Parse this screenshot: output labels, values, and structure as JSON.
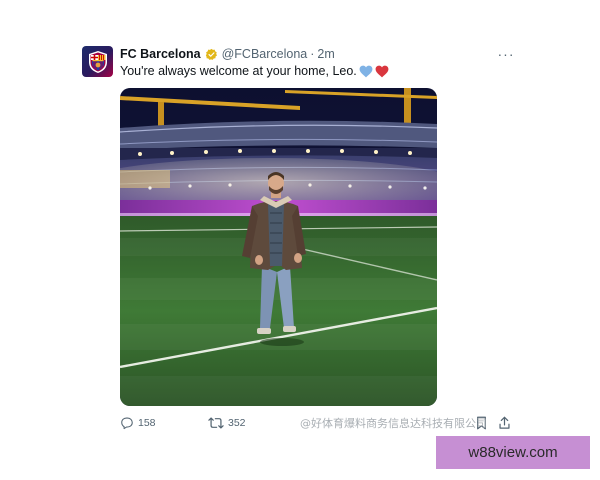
{
  "tweet": {
    "author_name": "FC Barcelona",
    "handle": "@FCBarcelona",
    "separator": "·",
    "time": "2m",
    "more_label": "···",
    "text": "You're always welcome at your home, Leo.",
    "image_alt": "Lionel Messi standing on the pitch of the stadium at night"
  },
  "actions": {
    "reply_count": "158",
    "retweet_count": "352"
  },
  "watermark": {
    "text": "@好体育爆料商务信息达科技有限公司",
    "site": "w88view.com"
  },
  "colors": {
    "blue_heart": "#7fb2e5",
    "red_heart": "#d9363e",
    "verified": "#e2b719",
    "watermark_bg": "#c68fd3"
  }
}
